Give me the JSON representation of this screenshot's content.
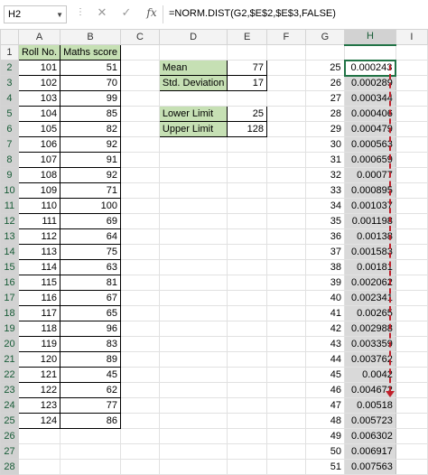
{
  "formula_bar": {
    "name_box": "H2",
    "formula": "=NORM.DIST(G2,$E$2,$E$3,FALSE)"
  },
  "columns": [
    "A",
    "B",
    "C",
    "D",
    "E",
    "F",
    "G",
    "H",
    "I"
  ],
  "row_numbers": [
    "1",
    "2",
    "3",
    "4",
    "5",
    "6",
    "7",
    "8",
    "9",
    "10",
    "11",
    "12",
    "13",
    "14",
    "15",
    "16",
    "17",
    "18",
    "19",
    "20",
    "21",
    "22",
    "23",
    "24",
    "25",
    "26",
    "27",
    "28"
  ],
  "headers": {
    "a1": "Roll No.",
    "b1": "Maths score"
  },
  "data_rows": [
    {
      "roll": "101",
      "score": "51"
    },
    {
      "roll": "102",
      "score": "70"
    },
    {
      "roll": "103",
      "score": "99"
    },
    {
      "roll": "104",
      "score": "85"
    },
    {
      "roll": "105",
      "score": "82"
    },
    {
      "roll": "106",
      "score": "92"
    },
    {
      "roll": "107",
      "score": "91"
    },
    {
      "roll": "108",
      "score": "92"
    },
    {
      "roll": "109",
      "score": "71"
    },
    {
      "roll": "110",
      "score": "100"
    },
    {
      "roll": "111",
      "score": "69"
    },
    {
      "roll": "112",
      "score": "64"
    },
    {
      "roll": "113",
      "score": "75"
    },
    {
      "roll": "114",
      "score": "63"
    },
    {
      "roll": "115",
      "score": "81"
    },
    {
      "roll": "116",
      "score": "67"
    },
    {
      "roll": "117",
      "score": "65"
    },
    {
      "roll": "118",
      "score": "96"
    },
    {
      "roll": "119",
      "score": "83"
    },
    {
      "roll": "120",
      "score": "89"
    },
    {
      "roll": "121",
      "score": "45"
    },
    {
      "roll": "122",
      "score": "62"
    },
    {
      "roll": "123",
      "score": "77"
    },
    {
      "roll": "124",
      "score": "86"
    }
  ],
  "stats": {
    "mean_label": "Mean",
    "mean_value": "77",
    "sd_label": "Std. Deviation",
    "sd_value": "17",
    "lower_label": "Lower Limit",
    "lower_value": "25",
    "upper_label": "Upper Limit",
    "upper_value": "128"
  },
  "g_values": [
    "25",
    "26",
    "27",
    "28",
    "29",
    "30",
    "31",
    "32",
    "33",
    "34",
    "35",
    "36",
    "37",
    "38",
    "39",
    "40",
    "41",
    "42",
    "43",
    "44",
    "45",
    "46",
    "47",
    "48",
    "49",
    "50",
    "51"
  ],
  "h_values": [
    "0.000243",
    "0.000289",
    "0.000344",
    "0.000406",
    "0.000479",
    "0.000563",
    "0.000659",
    "0.00077",
    "0.000895",
    "0.001037",
    "0.001198",
    "0.00138",
    "0.001583",
    "0.00181",
    "0.002062",
    "0.002341",
    "0.00265",
    "0.002988",
    "0.003359",
    "0.003762",
    "0.0042",
    "0.004672",
    "0.00518",
    "0.005723",
    "0.006302",
    "0.006917",
    "0.007563"
  ],
  "colors": {
    "accent": "#217346",
    "green_fill": "#c6e0b4",
    "selection": "#d9d9d9",
    "arrow": "#c0202a"
  }
}
